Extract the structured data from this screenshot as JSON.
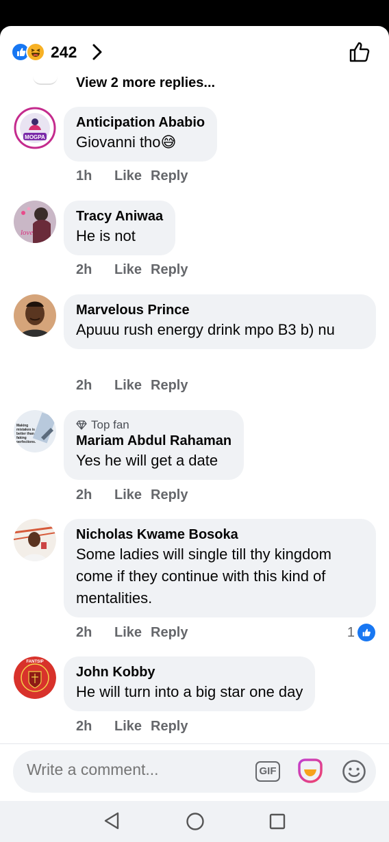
{
  "header": {
    "reaction_count": "242",
    "reactions": [
      "like",
      "haha"
    ]
  },
  "thread": {
    "view_more": "View 2 more replies..."
  },
  "comments": [
    {
      "author": "Anticipation Ababio",
      "text": "Giovanni tho😅",
      "time": "1h",
      "like": "Like",
      "reply": "Reply",
      "avatar_text": "MOGPA"
    },
    {
      "author": "Tracy Aniwaa",
      "text": "He is not",
      "time": "2h",
      "like": "Like",
      "reply": "Reply"
    },
    {
      "author": "Marvelous Prince",
      "text": "Apuuu rush energy drink mpo B3 b) nu",
      "time": "2h",
      "like": "Like",
      "reply": "Reply"
    },
    {
      "badge": "Top fan",
      "author": "Mariam Abdul Rahaman",
      "text": "Yes he will get a date",
      "time": "2h",
      "like": "Like",
      "reply": "Reply",
      "avatar_text": "Making mistakes is better than faking perfections."
    },
    {
      "author": "Nicholas Kwame Bosoka",
      "text": "Some ladies will single till thy kingdom come if they continue with this kind of mentalities.",
      "time": "2h",
      "like": "Like",
      "reply": "Reply",
      "like_count": "1"
    },
    {
      "author": "John Kobby",
      "text": "He will turn into a big star one day",
      "time": "2h",
      "like": "Like",
      "reply": "Reply",
      "avatar_text": "FANTSIP"
    }
  ],
  "composer": {
    "placeholder": "Write a comment...",
    "gif_label": "GIF"
  },
  "colors": {
    "accent": "#1877f2",
    "bubble": "#f0f2f5",
    "meta": "#65676b"
  }
}
